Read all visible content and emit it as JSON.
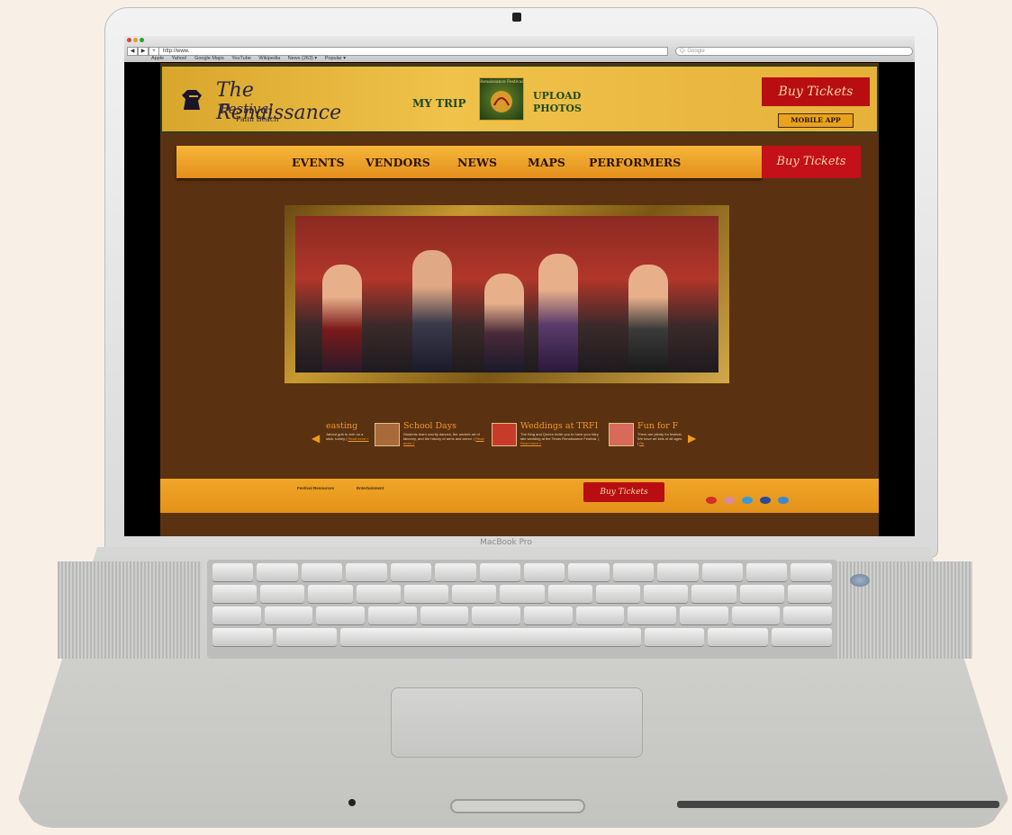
{
  "browser": {
    "url": "http://www.",
    "search_placeholder": "Q- Google",
    "back": "◀",
    "forward": "▶",
    "add": "+",
    "bookmarks": [
      "Apple",
      "Yahoo!",
      "Google Maps",
      "YouTube",
      "Wikipedia",
      "News (263) ▾",
      "Popular ▾"
    ]
  },
  "site": {
    "logo": {
      "line1": "The Renaissance",
      "line2": "Festival",
      "sub": "Palm Beach"
    },
    "my_trip": "MY TRIP",
    "app_tile_text": "Renaissance Festival",
    "upload_line1": "UPLOAD",
    "upload_line2": "PHOTOS",
    "buy_tickets": "Buy Tickets",
    "mobile_app": "MOBILE APP",
    "nav": [
      "EVENTS",
      "VENDORS",
      "NEWS",
      "MAPS",
      "PERFORMERS"
    ],
    "nav_buy": "Buy Tickets",
    "carousel": [
      {
        "title": "easting",
        "desc": "Jabout gob to arrh on a stick, turkey",
        "more": "Read more »"
      },
      {
        "title": "School Days",
        "desc": "Students learn courtly dances, the ancient art of falconry, and the history of arms and armor.",
        "more": "Read more »"
      },
      {
        "title": "Weddings at TRFI",
        "desc": "The King and Queen invite you to have your fairy tale wedding at the Texas Renaissance Festival.",
        "more": "Read more »"
      },
      {
        "title": "Fun for F",
        "desc": "There are plenty for festival. We have art kids of all ages.",
        "more": "Re"
      }
    ],
    "footer": {
      "col1_head": "Festival Resources",
      "col2_head": "Entertainment",
      "buy": "Buy Tickets"
    }
  },
  "device": {
    "label": "MacBook Pro"
  },
  "colors": {
    "brown": "#5a3212",
    "gold": "#f0c24a",
    "red": "#b80e12",
    "orange": "#f29a1e"
  }
}
